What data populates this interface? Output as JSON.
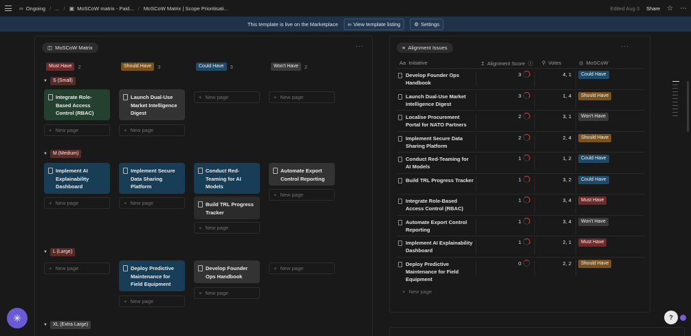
{
  "topbar": {
    "breadcrumbs": [
      "Ongoing",
      "...",
      "MoSCoW matrix - Paid...",
      "MoSCoW Matrix | Scope Prioritisati..."
    ],
    "edited": "Edited Aug 3",
    "share": "Share"
  },
  "banner": {
    "text": "This template is live on the Marketplace",
    "listing_button": "View template listing",
    "settings_button": "Settings"
  },
  "board": {
    "view_name": "MoSCoW Matrix",
    "columns": [
      {
        "label": "Must Have",
        "count": "2"
      },
      {
        "label": "Should Have",
        "count": "3"
      },
      {
        "label": "Could Have",
        "count": "3"
      },
      {
        "label": "Won't Have",
        "count": "2"
      }
    ],
    "groups": [
      "S (Small)",
      "M (Medium)",
      "L (Large)",
      "XL (Extra Large)"
    ],
    "cards": {
      "s_must": "Integrate Role-Based Access Control (RBAC)",
      "s_should": "Launch Dual-Use Market Intelligence Digest",
      "m_must": "Implement AI Explainability Dashboard",
      "m_should": "Implement Secure Data Sharing Platform",
      "m_could_1": "Conduct Red-Teaming for AI Models",
      "m_could_2": "Build TRL Progress Tracker",
      "m_wont": "Automate Export Control Reporting",
      "l_should": "Deploy Predictive Maintenance for Field Equipment",
      "l_could": "Develop Founder Ops Handbook"
    },
    "new_page": "New page"
  },
  "table": {
    "view_name": "Alignment Issues",
    "headers": {
      "initiative": "Initiative",
      "score": "Alignment Score",
      "votes": "Votes",
      "moscow": "MoSCoW"
    },
    "rows": [
      {
        "name": "Develop Founder Ops Handbook",
        "score": "3",
        "votes": "4, 1",
        "moscow": "Could Have"
      },
      {
        "name": "Launch Dual-Use Market Intelligence Digest",
        "score": "3",
        "votes": "1, 4",
        "moscow": "Should Have"
      },
      {
        "name": "Localise Procurement Portal for NATO Partners",
        "score": "2",
        "votes": "3, 1",
        "moscow": "Won't Have"
      },
      {
        "name": "Implement Secure Data Sharing Platform",
        "score": "2",
        "votes": "2, 4",
        "moscow": "Should Have"
      },
      {
        "name": "Conduct Red-Teaming for AI Models",
        "score": "1",
        "votes": "1, 2",
        "moscow": "Could Have"
      },
      {
        "name": "Build TRL Progress Tracker",
        "score": "1",
        "votes": "3, 2",
        "moscow": "Could Have"
      },
      {
        "name": "Integrate Role-Based Access Control (RBAC)",
        "score": "1",
        "votes": "3, 4",
        "moscow": "Must Have"
      },
      {
        "name": "Automate Export Control Reporting",
        "score": "1",
        "votes": "3, 4",
        "moscow": "Won't Have"
      },
      {
        "name": "Implement AI Explainability Dashboard",
        "score": "1",
        "votes": "2, 1",
        "moscow": "Must Have"
      },
      {
        "name": "Deploy Predictive Maintenance for Field Equipment",
        "score": "0",
        "votes": "2, 2",
        "moscow": "Should Have"
      }
    ],
    "new_page": "New page"
  },
  "colors": {
    "must": "#6e2b2b",
    "should": "#7b5219",
    "could": "#1e4a6a",
    "wont": "#3a3a3a",
    "banner": "#1f3248",
    "fab": "#6a5ad6"
  },
  "icons": [
    "menu-icon",
    "link-icon",
    "page-icon",
    "star-icon",
    "more-icon",
    "gear-icon",
    "board-icon",
    "table-icon",
    "doc-icon",
    "plus-icon",
    "sigma-icon",
    "search-icon",
    "target-icon",
    "text-icon",
    "help-icon"
  ]
}
